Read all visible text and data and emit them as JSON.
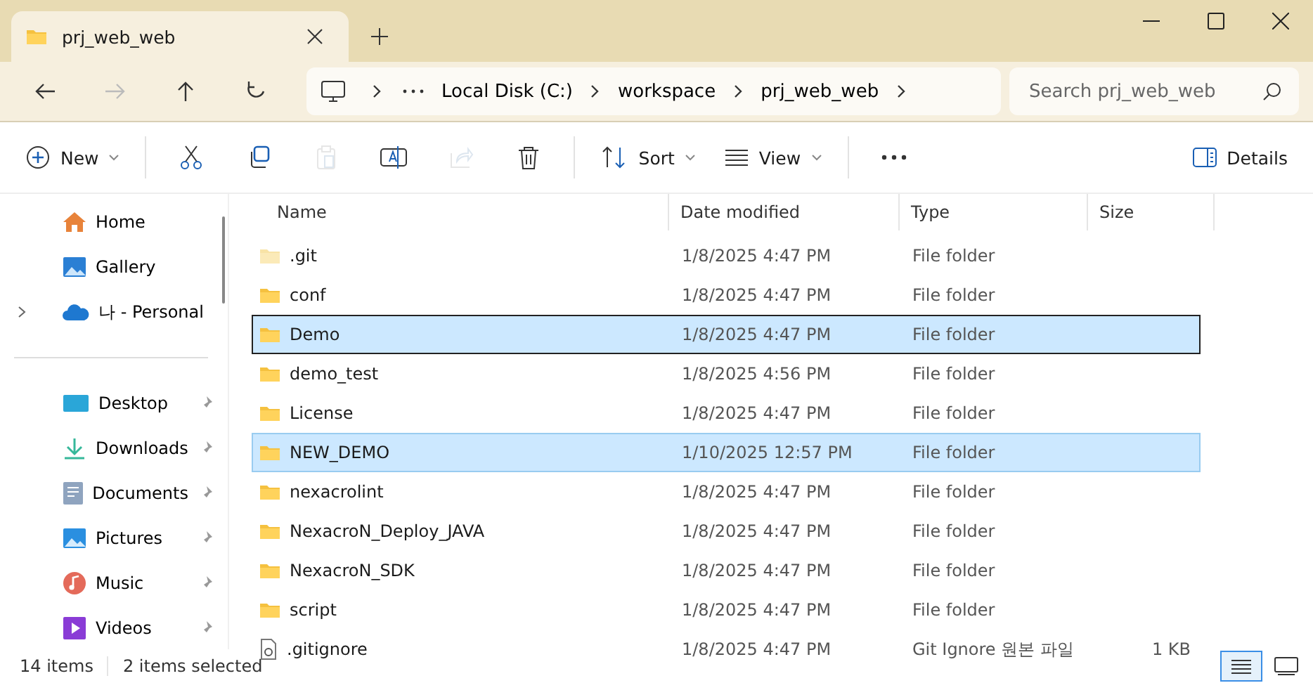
{
  "window": {
    "tab_title": "prj_web_web"
  },
  "address_bar": {
    "path": [
      "Local Disk (C:)",
      "workspace",
      "prj_web_web"
    ],
    "search": {
      "placeholder": "Search prj_web_web"
    }
  },
  "toolbar": {
    "buttons": [
      {
        "kind": "new",
        "label": "New",
        "disabled": false
      },
      {
        "kind": "cut",
        "disabled": false
      },
      {
        "kind": "copy",
        "disabled": false
      },
      {
        "kind": "paste",
        "disabled": true
      },
      {
        "kind": "rename",
        "disabled": false
      },
      {
        "kind": "share",
        "disabled": true
      },
      {
        "kind": "delete",
        "disabled": false
      },
      {
        "kind": "sort",
        "label": "Sort",
        "disabled": false
      },
      {
        "kind": "view",
        "label": "View",
        "disabled": false
      },
      {
        "kind": "more",
        "disabled": false
      }
    ],
    "details_label": "Details"
  },
  "sidebar": {
    "groups": [
      {
        "items": [
          {
            "kind": "home",
            "label": "Home",
            "pinned": false,
            "expandable": false
          },
          {
            "kind": "gallery",
            "label": "Gallery",
            "pinned": false,
            "expandable": false
          },
          {
            "kind": "cloud",
            "label": "나 - Personal",
            "pinned": false,
            "expandable": true
          }
        ]
      },
      {
        "items": [
          {
            "kind": "desktop",
            "label": "Desktop",
            "pinned": true,
            "expandable": false
          },
          {
            "kind": "downloads",
            "label": "Downloads",
            "pinned": true,
            "expandable": false
          },
          {
            "kind": "documents",
            "label": "Documents",
            "pinned": true,
            "expandable": false
          },
          {
            "kind": "pictures",
            "label": "Pictures",
            "pinned": true,
            "expandable": false
          },
          {
            "kind": "music",
            "label": "Music",
            "pinned": true,
            "expandable": false
          },
          {
            "kind": "videos",
            "label": "Videos",
            "pinned": true,
            "expandable": false
          }
        ]
      }
    ]
  },
  "table": {
    "columns": [
      "Name",
      "Date modified",
      "Type",
      "Size"
    ],
    "rows": [
      {
        "kind": "folder",
        "name": ".git",
        "date": "1/8/2025 4:47 PM",
        "type": "File folder",
        "size": null,
        "selected": false,
        "focused": false,
        "hidden": true
      },
      {
        "kind": "folder",
        "name": "conf",
        "date": "1/8/2025 4:47 PM",
        "type": "File folder",
        "size": null,
        "selected": false,
        "focused": false,
        "hidden": false
      },
      {
        "kind": "folder",
        "name": "Demo",
        "date": "1/8/2025 4:47 PM",
        "type": "File folder",
        "size": null,
        "selected": true,
        "focused": true,
        "hidden": false
      },
      {
        "kind": "folder",
        "name": "demo_test",
        "date": "1/8/2025 4:56 PM",
        "type": "File folder",
        "size": null,
        "selected": false,
        "focused": false,
        "hidden": false
      },
      {
        "kind": "folder",
        "name": "License",
        "date": "1/8/2025 4:47 PM",
        "type": "File folder",
        "size": null,
        "selected": false,
        "focused": false,
        "hidden": false
      },
      {
        "kind": "folder",
        "name": "NEW_DEMO",
        "date": "1/10/2025 12:57 PM",
        "type": "File folder",
        "size": null,
        "selected": true,
        "focused": false,
        "hidden": false
      },
      {
        "kind": "folder",
        "name": "nexacrolint",
        "date": "1/8/2025 4:47 PM",
        "type": "File folder",
        "size": null,
        "selected": false,
        "focused": false,
        "hidden": false
      },
      {
        "kind": "folder",
        "name": "NexacroN_Deploy_JAVA",
        "date": "1/8/2025 4:47 PM",
        "type": "File folder",
        "size": null,
        "selected": false,
        "focused": false,
        "hidden": false
      },
      {
        "kind": "folder",
        "name": "NexacroN_SDK",
        "date": "1/8/2025 4:47 PM",
        "type": "File folder",
        "size": null,
        "selected": false,
        "focused": false,
        "hidden": false
      },
      {
        "kind": "folder",
        "name": "script",
        "date": "1/8/2025 4:47 PM",
        "type": "File folder",
        "size": null,
        "selected": false,
        "focused": false,
        "hidden": false
      },
      {
        "kind": "file",
        "name": ".gitignore",
        "date": "1/8/2025 4:47 PM",
        "type": "Git Ignore 원본 파일",
        "size": "1 KB",
        "selected": false,
        "focused": false
      }
    ]
  },
  "status_bar": {
    "item_count": "14 items",
    "selection": "2 items selected"
  },
  "view_toggle": [
    {
      "kind": "details",
      "selected": true
    },
    {
      "kind": "tiles",
      "selected": false
    }
  ]
}
